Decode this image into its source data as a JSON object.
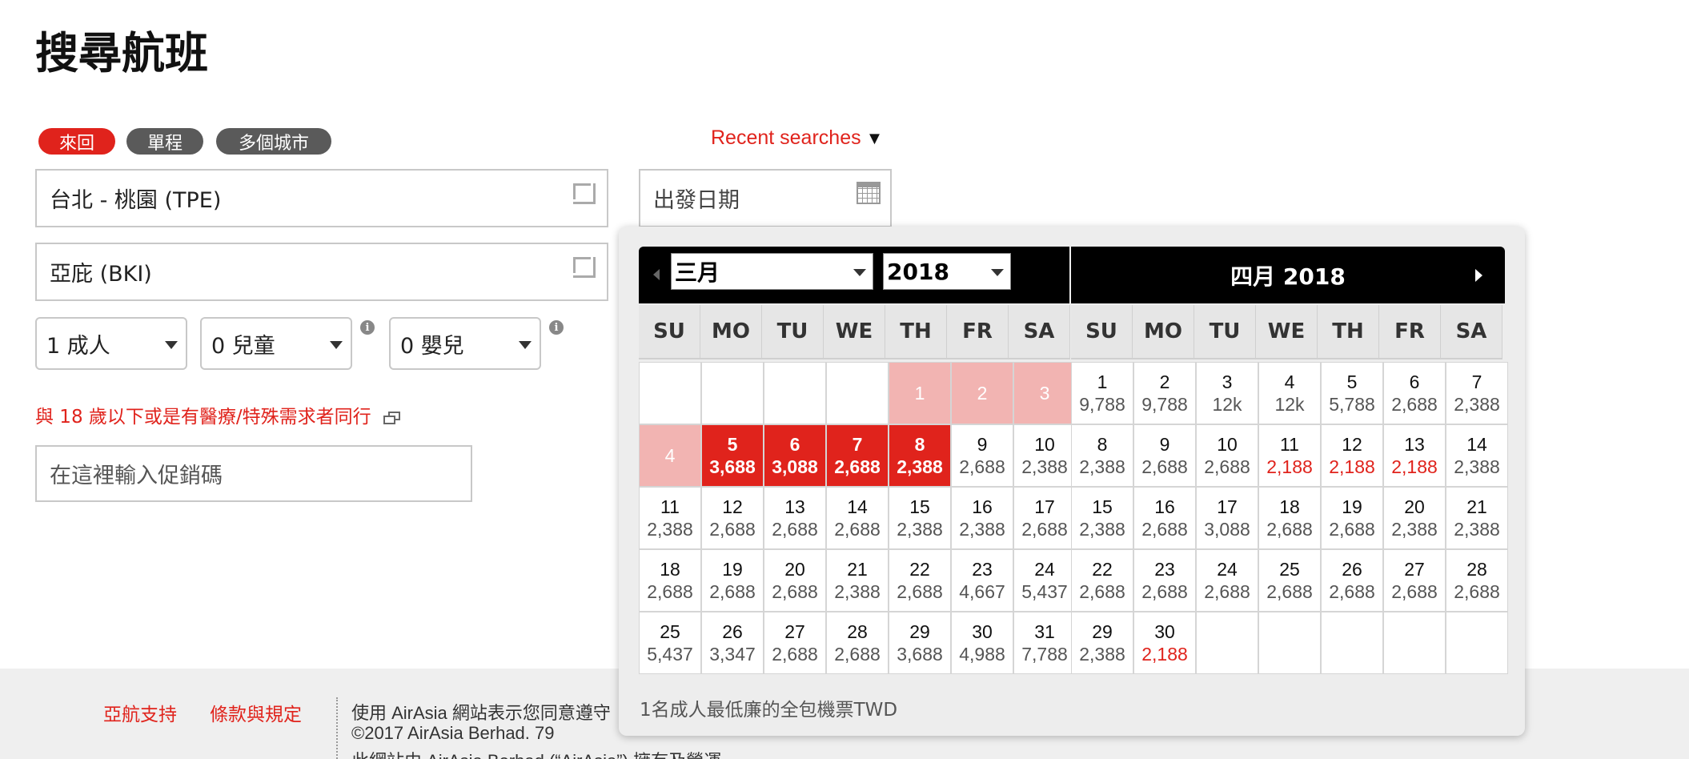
{
  "page": {
    "title": "搜尋航班"
  },
  "trip_types": [
    {
      "label": "來回",
      "active": true
    },
    {
      "label": "單程",
      "active": false
    },
    {
      "label": "多個城市",
      "active": false
    }
  ],
  "recent_searches": {
    "label": "Recent searches",
    "arrow": "▼"
  },
  "origin": {
    "value": "台北 - 桃園 (TPE)"
  },
  "destination": {
    "value": "亞庇 (BKI)"
  },
  "departure_date": {
    "placeholder": "出發日期"
  },
  "passengers": {
    "adults": "1 成人",
    "children": "0 兒童",
    "infants": "0 嬰兒",
    "info_glyph": "i"
  },
  "minor_link": "與 18 歲以下或是有醫療/特殊需求者同行",
  "promo": {
    "placeholder": "在這裡輸入促銷碼"
  },
  "footer": {
    "support_link": "亞航支持",
    "terms_link": "條款與規定",
    "line1": "使用 AirAsia 網站表示您同意遵守",
    "line2": "©2017 AirAsia Berhad. 79",
    "line3": "此網站由 AirAsia Berhad (“AirAsia”) 擁有及營運。"
  },
  "calendar": {
    "left": {
      "month_select": "三月",
      "year_select": "2018",
      "days_of_week": [
        "SU",
        "MO",
        "TU",
        "WE",
        "TH",
        "FR",
        "SA"
      ],
      "cells": [
        {
          "day": "",
          "price": "",
          "state": "empty"
        },
        {
          "day": "",
          "price": "",
          "state": "empty"
        },
        {
          "day": "",
          "price": "",
          "state": "empty"
        },
        {
          "day": "",
          "price": "",
          "state": "empty"
        },
        {
          "day": "1",
          "price": "",
          "state": "past"
        },
        {
          "day": "2",
          "price": "",
          "state": "past"
        },
        {
          "day": "3",
          "price": "",
          "state": "past"
        },
        {
          "day": "4",
          "price": "",
          "state": "past"
        },
        {
          "day": "5",
          "price": "3,688",
          "state": "selected"
        },
        {
          "day": "6",
          "price": "3,088",
          "state": "selected"
        },
        {
          "day": "7",
          "price": "2,688",
          "state": "selected"
        },
        {
          "day": "8",
          "price": "2,388",
          "state": "selected"
        },
        {
          "day": "9",
          "price": "2,688",
          "state": "normal"
        },
        {
          "day": "10",
          "price": "2,388",
          "state": "normal"
        },
        {
          "day": "11",
          "price": "2,388",
          "state": "normal"
        },
        {
          "day": "12",
          "price": "2,688",
          "state": "normal"
        },
        {
          "day": "13",
          "price": "2,688",
          "state": "normal"
        },
        {
          "day": "14",
          "price": "2,688",
          "state": "normal"
        },
        {
          "day": "15",
          "price": "2,388",
          "state": "normal"
        },
        {
          "day": "16",
          "price": "2,388",
          "state": "normal"
        },
        {
          "day": "17",
          "price": "2,688",
          "state": "normal"
        },
        {
          "day": "18",
          "price": "2,688",
          "state": "normal"
        },
        {
          "day": "19",
          "price": "2,688",
          "state": "normal"
        },
        {
          "day": "20",
          "price": "2,688",
          "state": "normal"
        },
        {
          "day": "21",
          "price": "2,388",
          "state": "normal"
        },
        {
          "day": "22",
          "price": "2,688",
          "state": "normal"
        },
        {
          "day": "23",
          "price": "4,667",
          "state": "normal"
        },
        {
          "day": "24",
          "price": "5,437",
          "state": "normal"
        },
        {
          "day": "25",
          "price": "5,437",
          "state": "normal"
        },
        {
          "day": "26",
          "price": "3,347",
          "state": "normal"
        },
        {
          "day": "27",
          "price": "2,688",
          "state": "normal"
        },
        {
          "day": "28",
          "price": "2,688",
          "state": "normal"
        },
        {
          "day": "29",
          "price": "3,688",
          "state": "normal"
        },
        {
          "day": "30",
          "price": "4,988",
          "state": "normal"
        },
        {
          "day": "31",
          "price": "7,788",
          "state": "normal"
        }
      ]
    },
    "right": {
      "header": "四月  2018",
      "days_of_week": [
        "SU",
        "MO",
        "TU",
        "WE",
        "TH",
        "FR",
        "SA"
      ],
      "cells": [
        {
          "day": "1",
          "price": "9,788",
          "state": "normal"
        },
        {
          "day": "2",
          "price": "9,788",
          "state": "normal"
        },
        {
          "day": "3",
          "price": "12k",
          "state": "normal"
        },
        {
          "day": "4",
          "price": "12k",
          "state": "normal"
        },
        {
          "day": "5",
          "price": "5,788",
          "state": "normal"
        },
        {
          "day": "6",
          "price": "2,688",
          "state": "normal"
        },
        {
          "day": "7",
          "price": "2,388",
          "state": "normal"
        },
        {
          "day": "8",
          "price": "2,388",
          "state": "normal"
        },
        {
          "day": "9",
          "price": "2,688",
          "state": "normal"
        },
        {
          "day": "10",
          "price": "2,688",
          "state": "normal"
        },
        {
          "day": "11",
          "price": "2,188",
          "state": "low"
        },
        {
          "day": "12",
          "price": "2,188",
          "state": "low"
        },
        {
          "day": "13",
          "price": "2,188",
          "state": "low"
        },
        {
          "day": "14",
          "price": "2,388",
          "state": "normal"
        },
        {
          "day": "15",
          "price": "2,388",
          "state": "normal"
        },
        {
          "day": "16",
          "price": "2,688",
          "state": "normal"
        },
        {
          "day": "17",
          "price": "3,088",
          "state": "normal"
        },
        {
          "day": "18",
          "price": "2,688",
          "state": "normal"
        },
        {
          "day": "19",
          "price": "2,688",
          "state": "normal"
        },
        {
          "day": "20",
          "price": "2,388",
          "state": "normal"
        },
        {
          "day": "21",
          "price": "2,388",
          "state": "normal"
        },
        {
          "day": "22",
          "price": "2,688",
          "state": "normal"
        },
        {
          "day": "23",
          "price": "2,688",
          "state": "normal"
        },
        {
          "day": "24",
          "price": "2,688",
          "state": "normal"
        },
        {
          "day": "25",
          "price": "2,688",
          "state": "normal"
        },
        {
          "day": "26",
          "price": "2,688",
          "state": "normal"
        },
        {
          "day": "27",
          "price": "2,688",
          "state": "normal"
        },
        {
          "day": "28",
          "price": "2,688",
          "state": "normal"
        },
        {
          "day": "29",
          "price": "2,388",
          "state": "normal"
        },
        {
          "day": "30",
          "price": "2,188",
          "state": "low"
        },
        {
          "day": "",
          "price": "",
          "state": "empty"
        },
        {
          "day": "",
          "price": "",
          "state": "empty"
        },
        {
          "day": "",
          "price": "",
          "state": "empty"
        },
        {
          "day": "",
          "price": "",
          "state": "empty"
        },
        {
          "day": "",
          "price": "",
          "state": "empty"
        }
      ]
    },
    "note": "1名成人最低廉的全包機票TWD"
  },
  "colors": {
    "accent": "#e0231c",
    "past_day": "#f2b4b2",
    "header": "#000000"
  }
}
